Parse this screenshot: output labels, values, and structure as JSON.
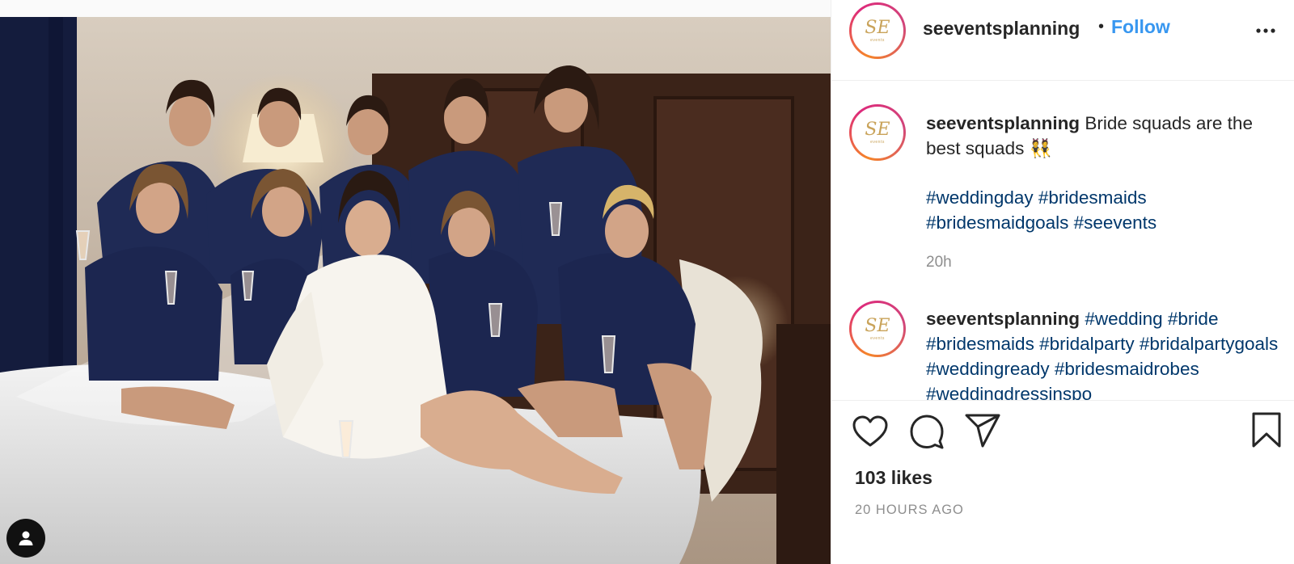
{
  "post": {
    "username": "seeventsplanning",
    "separator": "•",
    "follow_label": "Follow",
    "likes": "103 likes",
    "age": "20 HOURS AGO",
    "avatar_logo": "SE",
    "avatar_sub": "events"
  },
  "comments": [
    {
      "username": "seeventsplanning",
      "text": "Bride squads are the best squads 👯",
      "hashtags": "#weddingday #bridesmaids #bridesmaidgoals #seevents",
      "time": "20h"
    },
    {
      "username": "seeventsplanning",
      "hashtags": "#wedding #bride #bridesmaids #bridalparty #bridalpartygoals #weddingready #bridesmaidrobes #weddingdressinspo"
    }
  ],
  "icons": {
    "more": "more-options-icon",
    "like": "heart-icon",
    "comment": "comment-bubble-icon",
    "share": "paper-plane-icon",
    "save": "bookmark-icon",
    "tags": "user-tag-icon"
  },
  "colors": {
    "link_blue": "#3897f0",
    "hashtag_blue": "#00376b",
    "muted": "#8e8e8e",
    "avatar_gold": "#c9a35a"
  }
}
